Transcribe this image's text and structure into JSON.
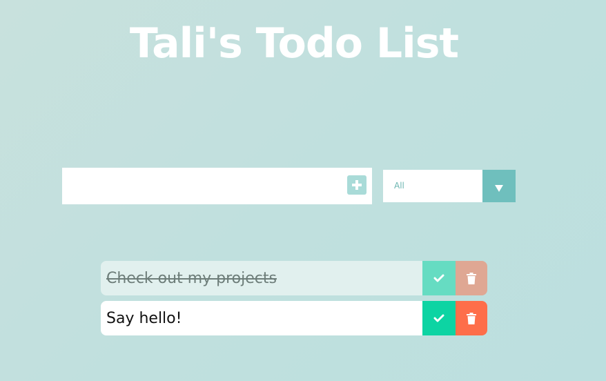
{
  "header": {
    "title": "Tali's Todo List"
  },
  "form": {
    "input_value": "",
    "add_icon": "plus-square-icon",
    "filter": {
      "selected": "All",
      "icon": "triangle-down-icon"
    }
  },
  "todos": [
    {
      "text": "Check out my projects",
      "completed": true,
      "check_icon": "check-icon",
      "delete_icon": "trash-icon"
    },
    {
      "text": "Say hello!",
      "completed": false,
      "check_icon": "check-icon",
      "delete_icon": "trash-icon"
    }
  ],
  "colors": {
    "complete_button": "#0dd4a3",
    "delete_button": "#fe6e4a",
    "filter_arrow": "#6fbfbd",
    "add_button": "#a9dbd8"
  }
}
